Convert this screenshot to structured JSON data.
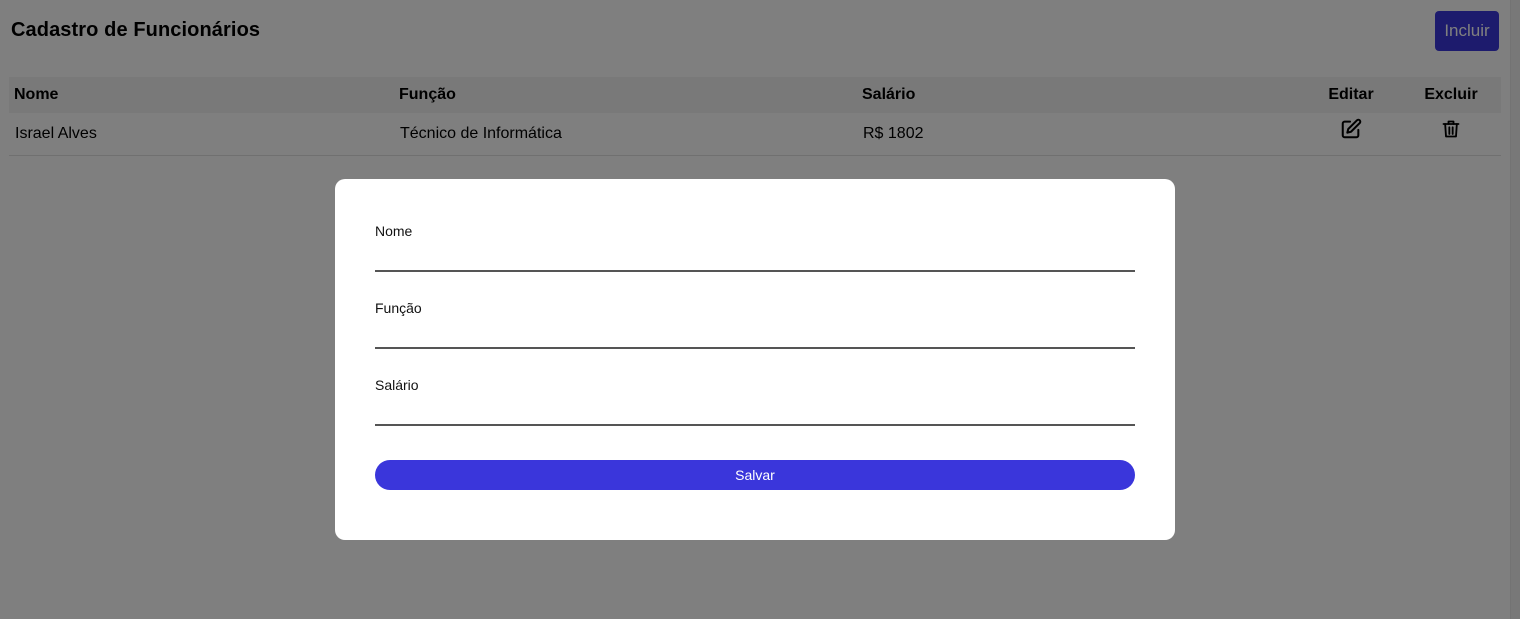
{
  "page": {
    "title": "Cadastro de Funcionários",
    "add_label": "Incluir"
  },
  "table": {
    "columns": [
      "Nome",
      "Função",
      "Salário",
      "Editar",
      "Excluir"
    ],
    "rows": [
      {
        "nome": "Israel Alves",
        "funcao": "Técnico de Informática",
        "salario": "R$ 1802"
      }
    ]
  },
  "modal": {
    "fields": [
      {
        "label": "Nome",
        "value": ""
      },
      {
        "label": "Função",
        "value": ""
      },
      {
        "label": "Salário",
        "value": ""
      }
    ],
    "save_label": "Salvar"
  },
  "icons": {
    "edit": "edit-icon",
    "delete": "trash-icon"
  },
  "colors": {
    "accent": "#3a36db",
    "overlay": "rgba(0,0,0,0.5)"
  }
}
